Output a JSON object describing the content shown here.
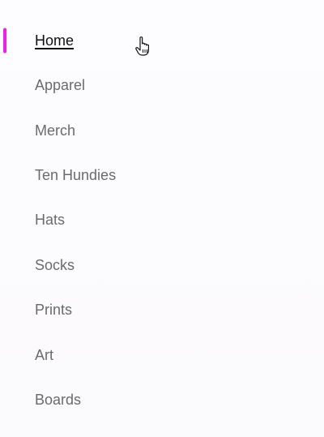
{
  "nav": {
    "items": [
      {
        "label": "Home",
        "active": true
      },
      {
        "label": "Apparel",
        "active": false
      },
      {
        "label": "Merch",
        "active": false
      },
      {
        "label": "Ten Hundies",
        "active": false
      },
      {
        "label": "Hats",
        "active": false
      },
      {
        "label": "Socks",
        "active": false
      },
      {
        "label": "Prints",
        "active": false
      },
      {
        "label": "Art",
        "active": false
      },
      {
        "label": "Boards",
        "active": false
      }
    ],
    "accent_color": "#ee1fea",
    "active_text_color": "#111111",
    "inactive_text_color": "#6b6b6b"
  },
  "cursor": {
    "icon": "hand-pointer-cursor-icon"
  }
}
